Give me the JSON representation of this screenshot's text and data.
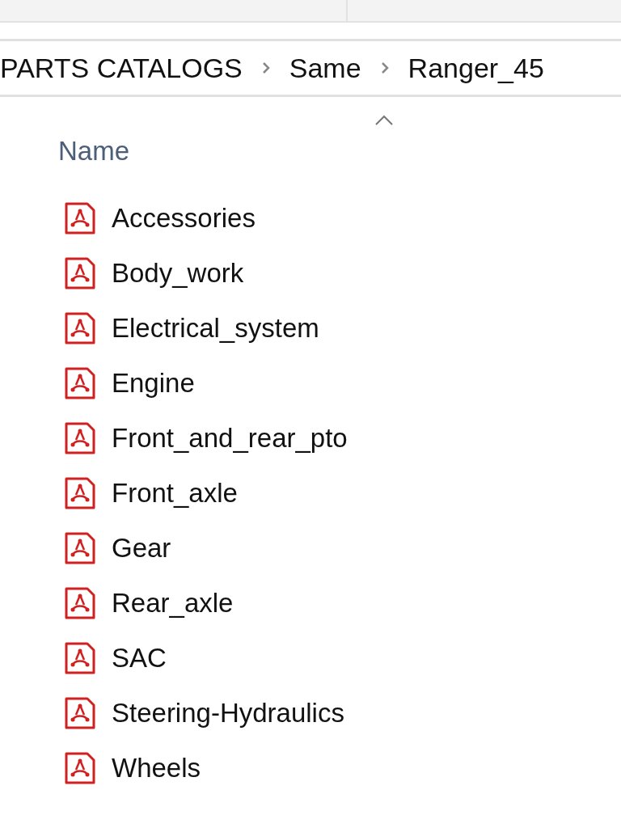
{
  "breadcrumb": [
    "PARTS CATALOGS",
    "Same",
    "Ranger_45"
  ],
  "column": {
    "label": "Name",
    "sort_ascending": true
  },
  "files": [
    {
      "name": "Accessories"
    },
    {
      "name": "Body_work"
    },
    {
      "name": "Electrical_system"
    },
    {
      "name": "Engine"
    },
    {
      "name": "Front_and_rear_pto"
    },
    {
      "name": "Front_axle"
    },
    {
      "name": "Gear"
    },
    {
      "name": "Rear_axle"
    },
    {
      "name": "SAC"
    },
    {
      "name": "Steering-Hydraulics"
    },
    {
      "name": "Wheels"
    }
  ]
}
